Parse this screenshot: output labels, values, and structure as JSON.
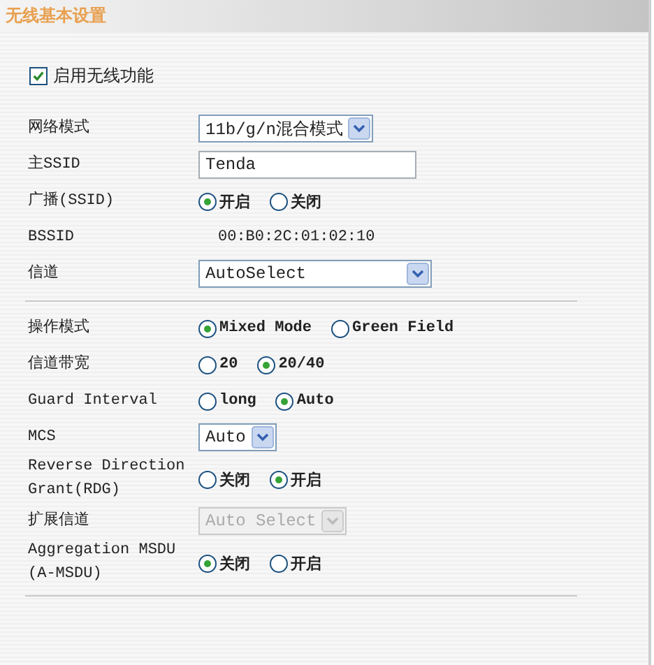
{
  "header": {
    "title": "无线基本设置"
  },
  "enable": {
    "label": "启用无线功能",
    "checked": true
  },
  "sections": [
    {
      "rows": [
        {
          "label": "网络模式",
          "kind": "select",
          "value": "11b/g/n混合模式",
          "disabled": false
        },
        {
          "label": "主SSID",
          "kind": "text",
          "value": "Tenda"
        },
        {
          "label": "广播(SSID)",
          "kind": "radio",
          "options": [
            {
              "label": "开启",
              "selected": true
            },
            {
              "label": "关闭",
              "selected": false
            }
          ]
        },
        {
          "label": "BSSID",
          "kind": "static",
          "value": "00:B0:2C:01:02:10"
        },
        {
          "label": "信道",
          "kind": "select",
          "value": "AutoSelect",
          "disabled": false
        }
      ]
    },
    {
      "rows": [
        {
          "label": "操作模式",
          "kind": "radio",
          "options": [
            {
              "label": "Mixed Mode",
              "selected": true
            },
            {
              "label": "Green Field",
              "selected": false
            }
          ]
        },
        {
          "label": "信道带宽",
          "kind": "radio",
          "options": [
            {
              "label": "20",
              "selected": false
            },
            {
              "label": "20/40",
              "selected": true
            }
          ]
        },
        {
          "label": "Guard Interval",
          "kind": "radio",
          "options": [
            {
              "label": "long",
              "selected": false
            },
            {
              "label": "Auto",
              "selected": true
            }
          ]
        },
        {
          "label": "MCS",
          "kind": "select",
          "value": "Auto",
          "disabled": false
        },
        {
          "label": "Reverse Direction Grant(RDG)",
          "kind": "radio",
          "options": [
            {
              "label": "关闭",
              "selected": false
            },
            {
              "label": "开启",
              "selected": true
            }
          ]
        },
        {
          "label": "扩展信道",
          "kind": "select",
          "value": "Auto Select",
          "disabled": true
        },
        {
          "label": "Aggregation MSDU (A-MSDU)",
          "kind": "radio",
          "options": [
            {
              "label": "关闭",
              "selected": true
            },
            {
              "label": "开启",
              "selected": false
            }
          ]
        }
      ]
    }
  ]
}
